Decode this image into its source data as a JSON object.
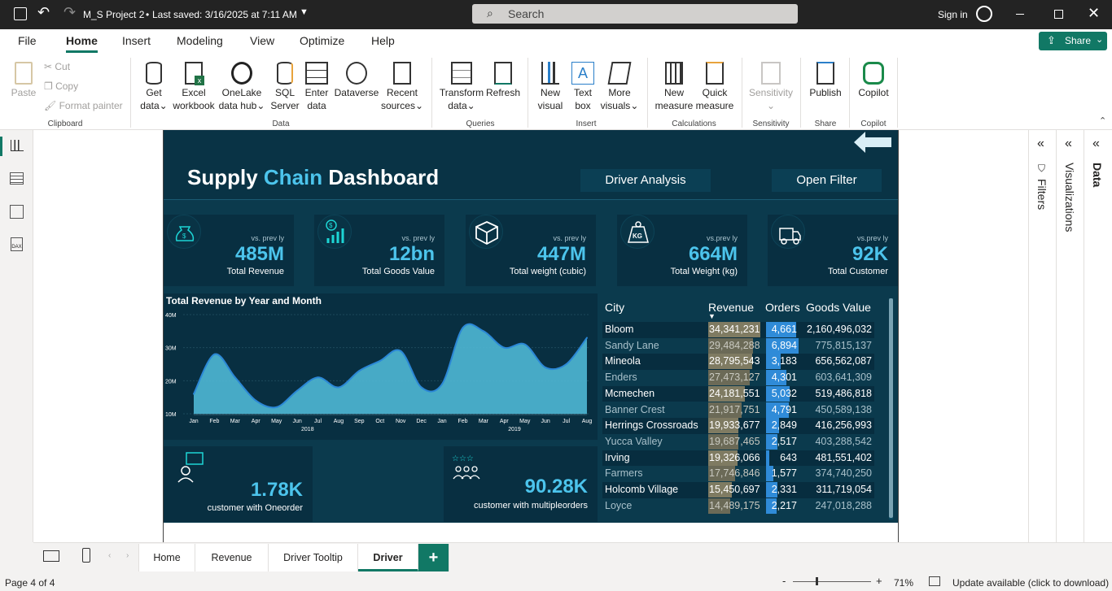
{
  "titlebar": {
    "file": "M_S Project 2",
    "saved": "Last saved: 3/16/2025 at 7:11 AM",
    "search": "Search",
    "signin": "Sign in"
  },
  "menu": {
    "file": "File",
    "home": "Home",
    "insert": "Insert",
    "modeling": "Modeling",
    "view": "View",
    "optimize": "Optimize",
    "help": "Help",
    "share": "Share"
  },
  "ribbon": {
    "clipboard": {
      "paste": "Paste",
      "cut": "Cut",
      "copy": "Copy",
      "format": "Format painter",
      "group": "Clipboard"
    },
    "data": {
      "get": "Get",
      "get2": "data",
      "excel": "Excel",
      "excel2": "workbook",
      "onelake": "OneLake",
      "onelake2": "data hub",
      "sql": "SQL",
      "sql2": "Server",
      "enter": "Enter",
      "enter2": "data",
      "dataverse": "Dataverse",
      "recent": "Recent",
      "recent2": "sources",
      "group": "Data"
    },
    "queries": {
      "transform": "Transform",
      "transform2": "data",
      "refresh": "Refresh",
      "group": "Queries"
    },
    "insert": {
      "newvisual": "New",
      "newvisual2": "visual",
      "textbox": "Text",
      "textbox2": "box",
      "more": "More",
      "more2": "visuals",
      "group": "Insert"
    },
    "calc": {
      "newmeasure": "New",
      "newmeasure2": "measure",
      "quick": "Quick",
      "quick2": "measure",
      "group": "Calculations"
    },
    "sens": {
      "label": "Sensitivity",
      "group": "Sensitivity"
    },
    "share": {
      "publish": "Publish",
      "group": "Share"
    },
    "copilot": {
      "label": "Copilot",
      "group": "Copilot"
    }
  },
  "dashboard": {
    "title_a": "Supply ",
    "title_b": "Chain",
    "title_c": " Dashboard",
    "btn_driver": "Driver Analysis",
    "btn_filter": "Open Filter",
    "cards": [
      {
        "vs": "vs. prev ly",
        "value": "485M",
        "label": "Total Revenue",
        "icon": "money-bag-icon"
      },
      {
        "vs": "vs. prev ly",
        "value": "12bn",
        "label": "Total Goods Value",
        "icon": "dollar-chart-icon"
      },
      {
        "vs": "vs. prev ly",
        "value": "447M",
        "label": "Total weight (cubic)",
        "icon": "box-icon"
      },
      {
        "vs": "vs.prev ly",
        "value": "664M",
        "label": "Total Weight (kg)",
        "icon": "weight-kg-icon"
      },
      {
        "vs": "vs.prev ly",
        "value": "92K",
        "label": "Total Customer",
        "icon": "truck-icon"
      }
    ],
    "small_cards": [
      {
        "value": "1.78K",
        "label": "customer with Oneorder"
      },
      {
        "value": "90.28K",
        "label": "customer with multipleorders"
      }
    ],
    "table": {
      "headers": [
        "City",
        "Revenue",
        "Orders",
        "Goods Value"
      ],
      "rows": [
        {
          "city": "Bloom",
          "revenue": "34,341,231",
          "orders": "4,661",
          "goods": "2,160,496,032",
          "rf": 1.0,
          "of": 0.92
        },
        {
          "city": "Sandy Lane",
          "revenue": "29,484,288",
          "orders": "6,894",
          "goods": "775,815,137",
          "rf": 0.86,
          "of": 1.0
        },
        {
          "city": "Mineola",
          "revenue": "28,795,543",
          "orders": "3,183",
          "goods": "656,562,087",
          "rf": 0.84,
          "of": 0.46
        },
        {
          "city": "Enders",
          "revenue": "27,473,127",
          "orders": "4,301",
          "goods": "603,641,309",
          "rf": 0.8,
          "of": 0.62
        },
        {
          "city": "Mcmechen",
          "revenue": "24,181,551",
          "orders": "5,032",
          "goods": "519,486,818",
          "rf": 0.7,
          "of": 0.73
        },
        {
          "city": "Banner Crest",
          "revenue": "21,917,751",
          "orders": "4,791",
          "goods": "450,589,138",
          "rf": 0.64,
          "of": 0.69
        },
        {
          "city": "Herrings Crossroads",
          "revenue": "19,933,677",
          "orders": "2,849",
          "goods": "416,256,993",
          "rf": 0.58,
          "of": 0.41
        },
        {
          "city": "Yucca Valley",
          "revenue": "19,687,465",
          "orders": "2,517",
          "goods": "403,288,542",
          "rf": 0.57,
          "of": 0.36
        },
        {
          "city": "Irving",
          "revenue": "19,326,066",
          "orders": "643",
          "goods": "481,551,402",
          "rf": 0.56,
          "of": 0.09
        },
        {
          "city": "Farmers",
          "revenue": "17,746,846",
          "orders": "1,577",
          "goods": "374,740,250",
          "rf": 0.52,
          "of": 0.23
        },
        {
          "city": "Holcomb Village",
          "revenue": "15,450,697",
          "orders": "2,331",
          "goods": "311,719,054",
          "rf": 0.45,
          "of": 0.34
        },
        {
          "city": "Loyce",
          "revenue": "14,489,175",
          "orders": "2,217",
          "goods": "247,018,288",
          "rf": 0.42,
          "of": 0.32
        }
      ]
    }
  },
  "chart_data": {
    "type": "area",
    "title": "Total Revenue by Year and Month",
    "x": [
      "Jan",
      "Feb",
      "Mar",
      "Apr",
      "May",
      "Jun",
      "Jul",
      "Aug",
      "Sep",
      "Oct",
      "Nov",
      "Dec",
      "Jan",
      "Feb",
      "Mar",
      "Apr",
      "May",
      "Jun",
      "Jul",
      "Aug"
    ],
    "years": [
      {
        "label": "2018",
        "from": 0,
        "to": 11
      },
      {
        "label": "2019",
        "from": 12,
        "to": 19
      }
    ],
    "values": [
      16,
      28,
      21,
      14,
      12,
      17,
      21,
      18,
      23,
      26,
      29,
      18,
      19,
      36,
      35,
      30,
      31,
      24,
      25,
      33
    ],
    "yticks": [
      "10M",
      "20M",
      "30M",
      "40M"
    ],
    "ylim": [
      10,
      40
    ],
    "color": "#4fb8d5"
  },
  "tabs": {
    "home": "Home",
    "revenue": "Revenue",
    "tooltip": "Driver Tooltip",
    "driver": "Driver",
    "add": "+"
  },
  "panes": {
    "filters": "Filters",
    "visualizations": "Visualizations",
    "data": "Data"
  },
  "status": {
    "page": "Page 4 of 4",
    "zoom": "71%",
    "update": "Update available (click to download)"
  }
}
